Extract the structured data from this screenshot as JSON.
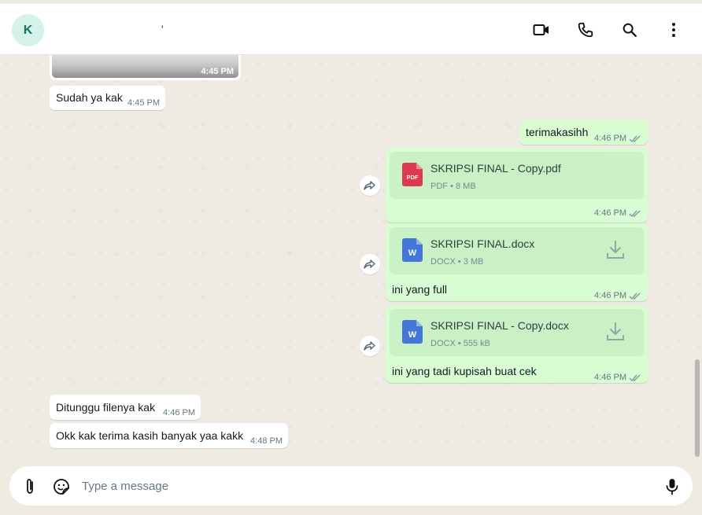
{
  "header": {
    "avatar_initial": "K",
    "contact_name": "'",
    "icons": [
      "video-call-icon",
      "phone-icon",
      "search-icon",
      "menu-dots-icon"
    ]
  },
  "messages": {
    "image_time": "4:45 PM",
    "m1": {
      "text": "Sudah ya kak",
      "time": "4:45 PM"
    },
    "m2": {
      "text": "terimakasihh",
      "time": "4:46 PM"
    },
    "doc1": {
      "name": "SKRIPSI FINAL - Copy.pdf",
      "type": "PDF",
      "size": "8 MB",
      "time": "4:46 PM"
    },
    "doc2": {
      "name": "SKRIPSI FINAL.docx",
      "type": "DOCX",
      "size": "3 MB",
      "caption": "ini yang full",
      "time": "4:46 PM"
    },
    "doc3": {
      "name": "SKRIPSI FINAL - Copy.docx",
      "type": "DOCX",
      "size": "555 kB",
      "caption": "ini yang tadi kupisah buat cek",
      "time": "4:46 PM"
    },
    "m3": {
      "text": "Ditunggu filenya kak",
      "time": "4:46 PM"
    },
    "m4": {
      "text": "Okk kak terima kasih banyak yaa kakk",
      "time": "4:48 PM"
    },
    "meta_sep": "•"
  },
  "composer": {
    "placeholder": "Type a message"
  },
  "colors": {
    "outgoing": "#d9fdd3",
    "incoming": "#ffffff",
    "pdf": "#e0173a",
    "word": "#2b5fd9",
    "avatar_bg": "#d4f2ea"
  }
}
